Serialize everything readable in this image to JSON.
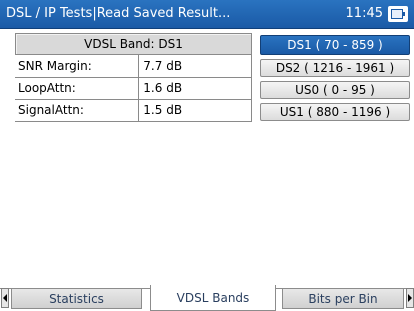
{
  "titlebar": {
    "title": "DSL / IP Tests|Read Saved Result...",
    "time": "11:45",
    "status_icon": "battery-charging-icon"
  },
  "results": {
    "header": "VDSL Band: DS1",
    "rows": [
      {
        "label": "SNR Margin:",
        "value": "7.7 dB"
      },
      {
        "label": "LoopAttn:",
        "value": "1.6 dB"
      },
      {
        "label": "SignalAttn:",
        "value": "1.5 dB"
      }
    ]
  },
  "bands": [
    {
      "label": "DS1 ( 70 - 859 )",
      "selected": true
    },
    {
      "label": "DS2 ( 1216 - 1961 )",
      "selected": false
    },
    {
      "label": "US0 ( 0 - 95 )",
      "selected": false
    },
    {
      "label": "US1 ( 880 - 1196 )",
      "selected": false
    }
  ],
  "tabs": [
    {
      "label": "Statistics",
      "active": false
    },
    {
      "label": "VDSL Bands",
      "active": true
    },
    {
      "label": "Bits per Bin",
      "active": false
    }
  ],
  "colors": {
    "accent": "#1a5aa6",
    "tab_text": "#2a3f5f"
  }
}
